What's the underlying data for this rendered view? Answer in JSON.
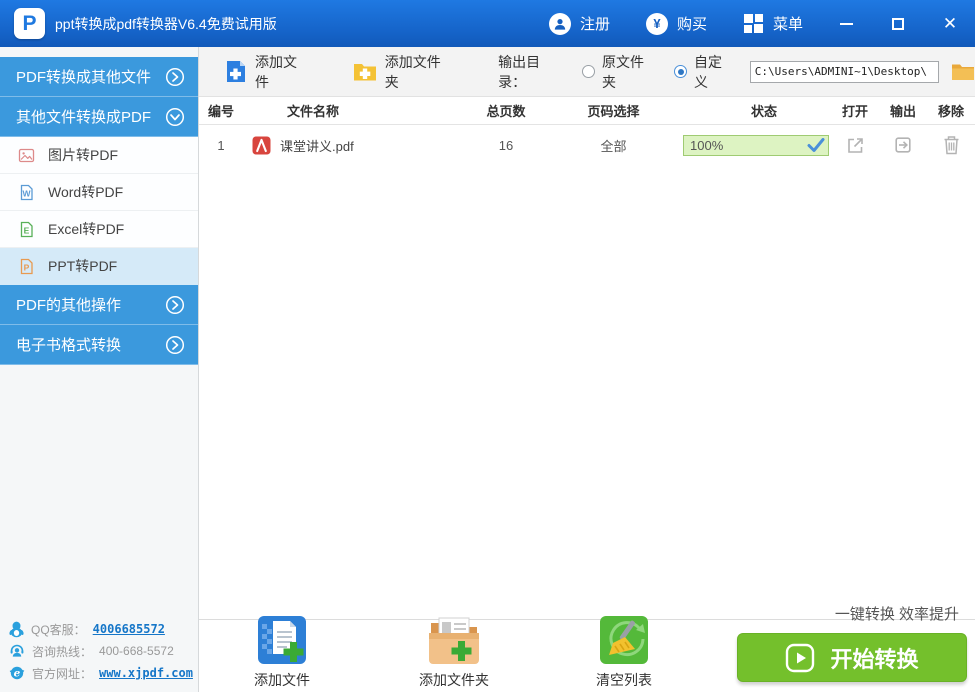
{
  "window": {
    "title": "ppt转换成pdf转换器V6.4免费试用版"
  },
  "titlebar": {
    "register": "注册",
    "buy": "购买",
    "buy_symbol": "¥",
    "menu": "菜单",
    "logo_letter": "P"
  },
  "sidebar": {
    "items": [
      {
        "label": "PDF转换成其他文件",
        "type": "group",
        "state": "collapsed"
      },
      {
        "label": "其他文件转换成PDF",
        "type": "group",
        "state": "expanded"
      },
      {
        "label": "图片转PDF",
        "type": "sub",
        "selected": false
      },
      {
        "label": "Word转PDF",
        "type": "sub",
        "selected": false
      },
      {
        "label": "Excel转PDF",
        "type": "sub",
        "selected": false
      },
      {
        "label": "PPT转PDF",
        "type": "sub",
        "selected": true
      },
      {
        "label": "PDF的其他操作",
        "type": "group",
        "state": "collapsed"
      },
      {
        "label": "电子书格式转换",
        "type": "group",
        "state": "collapsed"
      }
    ]
  },
  "toolbar": {
    "add_file": "添加文件",
    "add_folder": "添加文件夹",
    "output_dir_label": "输出目录：",
    "radio_original": "原文件夹",
    "radio_custom": "自定义",
    "radio_selected": "自定义",
    "path_value": "C:\\Users\\ADMINI~1\\Desktop\\"
  },
  "table": {
    "headers": [
      "编号",
      "文件名称",
      "总页数",
      "页码选择",
      "状态",
      "打开",
      "输出",
      "移除"
    ],
    "rows": [
      {
        "num": "1",
        "name": "课堂讲义.pdf",
        "pages": "16",
        "page_select": "全部",
        "progress": "100%",
        "status": "done"
      }
    ]
  },
  "contact": {
    "qq_label": "QQ客服：",
    "qq_value": "4006685572",
    "hotline_label": "咨询热线：",
    "hotline_value": "400-668-5572",
    "site_label": "官方网址：",
    "site_value": "www.xjpdf.com"
  },
  "footer": {
    "add_file": "添加文件",
    "add_folder": "添加文件夹",
    "clear_list": "清空列表",
    "slogan": "一键转换 效率提升",
    "start": "开始转换"
  },
  "icons": {
    "logo": "p-logo",
    "register": "user-circle",
    "buy": "yen-circle",
    "menu": "grid-2x2",
    "group_collapsed": "chevron-right-circle",
    "group_expanded": "chevron-down-circle",
    "image_to_pdf": "picture-doc",
    "word_to_pdf": "w-doc",
    "excel_to_pdf": "e-doc",
    "ppt_to_pdf": "p-doc",
    "row_file": "pdf-red",
    "open": "external-link",
    "output": "box-arrow-right",
    "remove": "trash",
    "progress_done": "blue-check",
    "contact_qq": "qq-penguin",
    "contact_hotline": "headset-person",
    "contact_site": "ie-globe",
    "start": "play-rounded-square"
  },
  "colors": {
    "titlebar_blue": "#1a6cd4",
    "sidebar_group_blue": "#3b99dd",
    "selected_item_blue": "#d5eaf8",
    "accent_green_button": "#74c02c",
    "progress_green_fill": "#ddf3c2",
    "progress_green_border": "#9fcb72",
    "check_blue": "#4a90d9",
    "link_blue": "#1576c8",
    "pdf_red": "#d8453e",
    "folder_yellow": "#f0b43c"
  }
}
